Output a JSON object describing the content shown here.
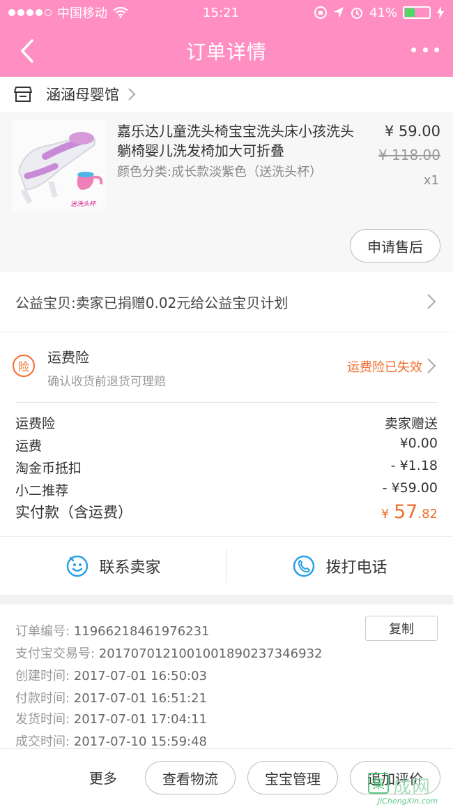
{
  "status_bar": {
    "carrier": "中国移动",
    "time": "15:21",
    "battery": "41%",
    "battery_level": 0.41
  },
  "header": {
    "title": "订单详情"
  },
  "shop": {
    "name": "涵涵母婴馆"
  },
  "product": {
    "title": "嘉乐达儿童洗头椅宝宝洗头床小孩洗头躺椅婴儿洗发椅加大可折叠",
    "sku": "颜色分类:成长款淡紫色（送洗头杯）",
    "price": "¥ 59.00",
    "original_price": "¥ 118.00",
    "quantity": "x1",
    "image_caption": "送洗头杯",
    "after_sale_label": "申请售后"
  },
  "charity": {
    "text": "公益宝贝:卖家已捐赠0.02元给公益宝贝计划"
  },
  "insurance": {
    "icon_char": "险",
    "title": "运费险",
    "subtitle": "确认收货前退货可理赔",
    "status": "运费险已失效"
  },
  "fees": {
    "rows": [
      {
        "label": "运费险",
        "value": "卖家赠送"
      },
      {
        "label": "运费",
        "value": "¥0.00"
      },
      {
        "label": "淘金币抵扣",
        "value": "- ¥1.18"
      },
      {
        "label": "小二推荐",
        "value": "- ¥59.00"
      }
    ],
    "total_label": "实付款（含运费）",
    "total_currency": "¥",
    "total_int": "57",
    "total_dec": ".82"
  },
  "contact": {
    "seller_label": "联系卖家",
    "phone_label": "拨打电话"
  },
  "order_info": {
    "copy_label": "复制",
    "rows": [
      {
        "label": "订单编号:",
        "value": "11966218461976231"
      },
      {
        "label": "支付宝交易号:",
        "value": "2017070121001001890237346932"
      },
      {
        "label": "创建时间:",
        "value": "2017-07-01 16:50:03"
      },
      {
        "label": "付款时间:",
        "value": "2017-07-01 16:51:21"
      },
      {
        "label": "发货时间:",
        "value": "2017-07-01 17:04:11"
      },
      {
        "label": "成交时间:",
        "value": "2017-07-10 15:59:48"
      }
    ]
  },
  "bottom_bar": {
    "more_label": "更多",
    "logistics_label": "查看物流",
    "manage_label": "宝宝管理",
    "review_label": "追加评价"
  },
  "watermark": {
    "box_char": "集",
    "text": "成网",
    "url": "JiChengXin.com"
  },
  "colors": {
    "header_pink": "#ff8fc2",
    "accent_orange": "#f06d2d",
    "contact_blue": "#29a0e6"
  }
}
